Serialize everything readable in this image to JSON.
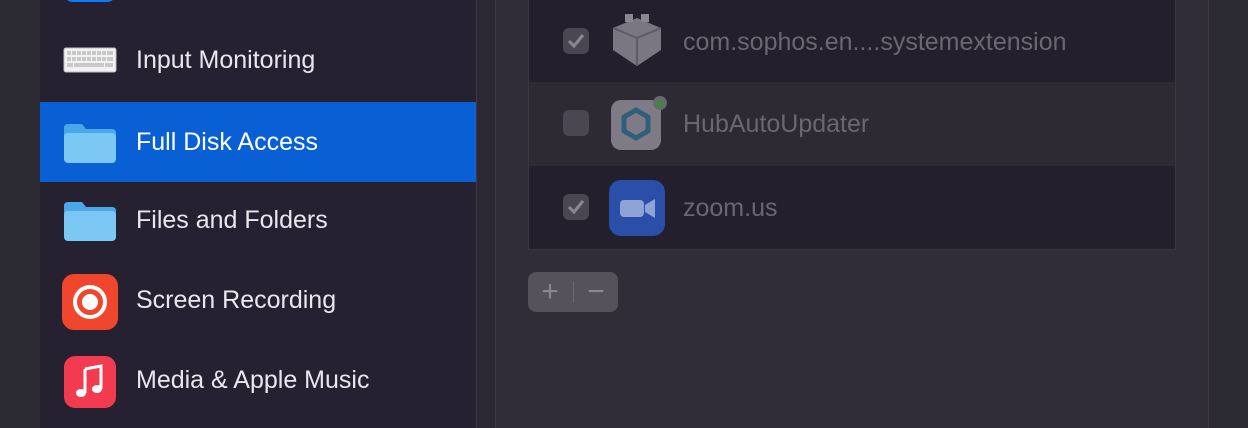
{
  "sidebar": {
    "items": [
      {
        "label": "",
        "icon": "blue-circle-icon"
      },
      {
        "label": "Input Monitoring",
        "icon": "keyboard-icon"
      },
      {
        "label": "Full Disk Access",
        "icon": "folder-icon",
        "selected": true
      },
      {
        "label": "Files and Folders",
        "icon": "folder-icon"
      },
      {
        "label": "Screen Recording",
        "icon": "screen-recording-icon"
      },
      {
        "label": "Media & Apple Music",
        "icon": "music-note-icon"
      }
    ]
  },
  "apps": [
    {
      "name": "com.sophos.en....systemextension",
      "checked": true,
      "icon": "sophos-extension-icon"
    },
    {
      "name": "HubAutoUpdater",
      "checked": false,
      "icon": "hub-auto-updater-icon"
    },
    {
      "name": "zoom.us",
      "checked": true,
      "icon": "zoom-camera-icon"
    }
  ],
  "controls": {
    "add_label": "+",
    "remove_label": "−"
  },
  "colors": {
    "selection": "#0860d4",
    "zoom_blue": "#2a5ad8"
  }
}
